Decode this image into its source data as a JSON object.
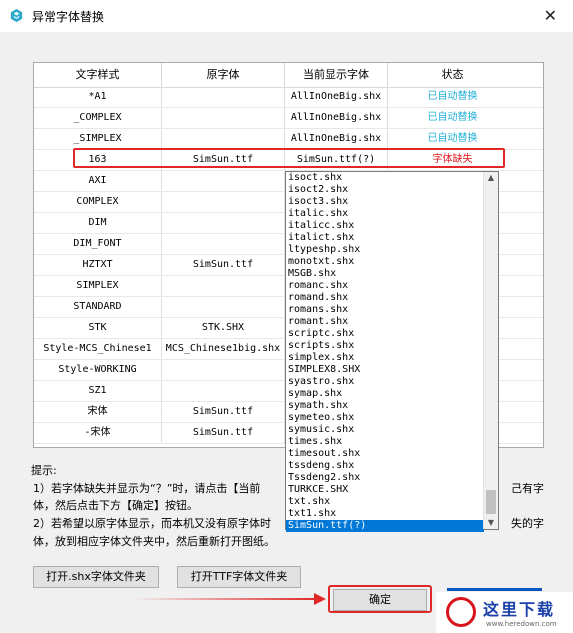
{
  "window": {
    "title": "异常字体替换",
    "close_glyph": "✕",
    "app_icon": "app-logo-icon"
  },
  "table": {
    "headers": [
      "文字样式",
      "原字体",
      "当前显示字体",
      "状态"
    ],
    "rows": [
      {
        "style": "*A1",
        "original": "",
        "current": "AllInOneBig.shx",
        "status": "已自动替换",
        "kind": "ok"
      },
      {
        "style": "_COMPLEX",
        "original": "",
        "current": "AllInOneBig.shx",
        "status": "已自动替换",
        "kind": "ok"
      },
      {
        "style": "_SIMPLEX",
        "original": "",
        "current": "AllInOneBig.shx",
        "status": "已自动替换",
        "kind": "ok"
      },
      {
        "style": "163",
        "original": "SimSun.ttf",
        "current": "SimSun.ttf(?)",
        "status": "字体缺失",
        "kind": "missing"
      },
      {
        "style": "AXI",
        "original": "",
        "current": "",
        "status": "",
        "kind": ""
      },
      {
        "style": "COMPLEX",
        "original": "",
        "current": "",
        "status": "",
        "kind": ""
      },
      {
        "style": "DIM",
        "original": "",
        "current": "",
        "status": "",
        "kind": ""
      },
      {
        "style": "DIM_FONT",
        "original": "",
        "current": "",
        "status": "",
        "kind": ""
      },
      {
        "style": "HZTXT",
        "original": "SimSun.ttf",
        "current": "",
        "status": "",
        "kind": ""
      },
      {
        "style": "SIMPLEX",
        "original": "",
        "current": "",
        "status": "",
        "kind": ""
      },
      {
        "style": "STANDARD",
        "original": "",
        "current": "",
        "status": "",
        "kind": ""
      },
      {
        "style": "STK",
        "original": "STK.SHX",
        "current": "",
        "status": "",
        "kind": ""
      },
      {
        "style": "Style-MCS_Chinese1",
        "original": "MCS_Chinese1big.shx",
        "current": "",
        "status": "",
        "kind": ""
      },
      {
        "style": "Style-WORKING",
        "original": "",
        "current": "",
        "status": "",
        "kind": ""
      },
      {
        "style": "SZ1",
        "original": "",
        "current": "",
        "status": "",
        "kind": ""
      },
      {
        "style": "宋体",
        "original": "SimSun.ttf",
        "current": "",
        "status": "",
        "kind": ""
      },
      {
        "style": "-宋体",
        "original": "SimSun.ttf",
        "current": "",
        "status": "",
        "kind": ""
      }
    ]
  },
  "dropdown": {
    "items": [
      "isoct.shx",
      "isoct2.shx",
      "isoct3.shx",
      "italic.shx",
      "italicc.shx",
      "italict.shx",
      "ltypeshp.shx",
      "monotxt.shx",
      "MSGB.shx",
      "romanc.shx",
      "romand.shx",
      "romans.shx",
      "romant.shx",
      "scriptc.shx",
      "scripts.shx",
      "simplex.shx",
      "SIMPLEX8.SHX",
      "syastro.shx",
      "symap.shx",
      "symath.shx",
      "symeteo.shx",
      "symusic.shx",
      "times.shx",
      "timesout.shx",
      "tssdeng.shx",
      "Tssdeng2.shx",
      "TURKCE.SHX",
      "txt.shx",
      "txt1.shx",
      "SimSun.ttf(?)"
    ],
    "selected": "SimSun.ttf(?)",
    "up_glyph": "▲",
    "down_glyph": "▼"
  },
  "hints": {
    "label": "提示:",
    "line1a": "1）若字体缺失并显示为“？”时，请点击【当前",
    "line1b": "己有字",
    "line2": "体，然后点击下方【确定】按钮。",
    "line3a": "2）若希望以原字体显示，而本机又没有原字体时",
    "line3b": "失的字",
    "line4": "体，放到相应字体文件夹中，然后重新打开图纸。"
  },
  "buttons": {
    "open_shx": "打开.shx字体文件夹",
    "open_ttf": "打开TTF字体文件夹",
    "ok": "确定"
  },
  "watermark": {
    "text": "这里下载",
    "url": "www.heredown.com"
  },
  "colors": {
    "status_ok": "#23b0d8",
    "status_missing": "#e0141e",
    "highlight": "#e02828",
    "selected": "#0078d7"
  }
}
